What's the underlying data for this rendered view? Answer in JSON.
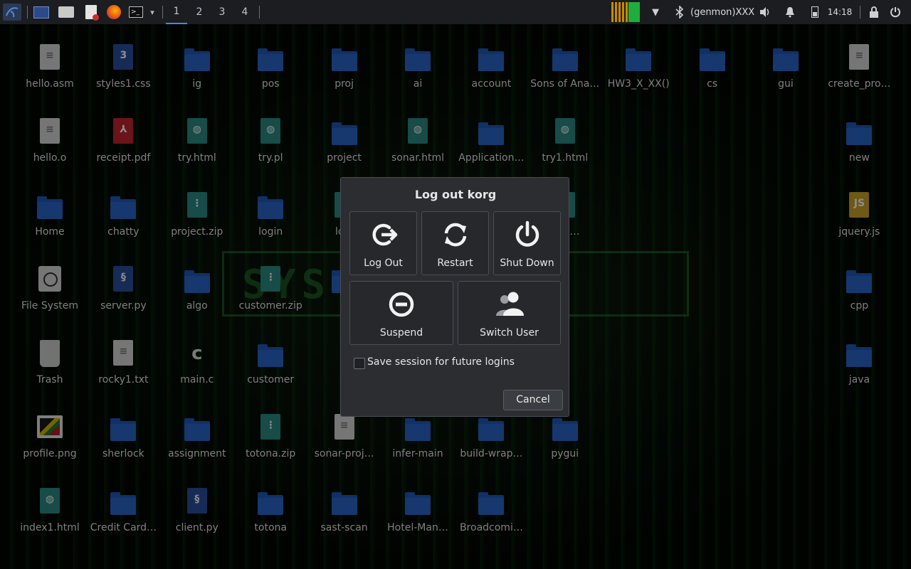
{
  "panel": {
    "workspaces": [
      "1",
      "2",
      "3",
      "4"
    ],
    "genmon": "(genmon)XXX",
    "clock": "14:18",
    "colors": {
      "panel_bg": "#1b1d20",
      "cpu_bar": "#c88a00",
      "net_bar": "#1fae3c"
    },
    "apps": [
      "kali-menu-icon",
      "desktop-icon",
      "file-manager-icon",
      "text-editor-icon",
      "firefox-icon",
      "terminal-icon"
    ]
  },
  "desktop": {
    "icons": [
      {
        "label": "hello.asm",
        "type": "doc"
      },
      {
        "label": "styles1.css",
        "type": "css"
      },
      {
        "label": "ig",
        "type": "folder"
      },
      {
        "label": "pos",
        "type": "folder"
      },
      {
        "label": "proj",
        "type": "folder"
      },
      {
        "label": "ai",
        "type": "folder"
      },
      {
        "label": "account",
        "type": "folder"
      },
      {
        "label": "Sons of Ana…",
        "type": "folder"
      },
      {
        "label": "HW3_X_XX()",
        "type": "folder"
      },
      {
        "label": "cs",
        "type": "folder"
      },
      {
        "label": "gui",
        "type": "folder"
      },
      {
        "label": "create_pro…",
        "type": "doc"
      },
      {
        "label": "hello.o",
        "type": "doc"
      },
      {
        "label": "receipt.pdf",
        "type": "pdf"
      },
      {
        "label": "try.html",
        "type": "html"
      },
      {
        "label": "try.pl",
        "type": "html"
      },
      {
        "label": "project",
        "type": "folder"
      },
      {
        "label": "sonar.html",
        "type": "html"
      },
      {
        "label": "Application…",
        "type": "folder"
      },
      {
        "label": "try1.html",
        "type": "html"
      },
      {
        "label": "new",
        "type": "folder"
      },
      {
        "label": "Home",
        "type": "folder"
      },
      {
        "label": "chatty",
        "type": "folder"
      },
      {
        "label": "project.zip",
        "type": "zip"
      },
      {
        "label": "login",
        "type": "folder"
      },
      {
        "label": "logi",
        "type": "zip"
      },
      {
        "label": "e.ht…",
        "type": "html"
      },
      {
        "label": "jquery.js",
        "type": "js"
      },
      {
        "label": "File System",
        "type": "drive"
      },
      {
        "label": "server.py",
        "type": "py"
      },
      {
        "label": "algo",
        "type": "folder"
      },
      {
        "label": "customer.zip",
        "type": "zip"
      },
      {
        "label": "cl",
        "type": "folder"
      },
      {
        "label": "cpp",
        "type": "folder"
      },
      {
        "label": "Trash",
        "type": "trash"
      },
      {
        "label": "rocky1.txt",
        "type": "doc"
      },
      {
        "label": "main.c",
        "type": "c"
      },
      {
        "label": "customer",
        "type": "folder"
      },
      {
        "label": "java",
        "type": "folder"
      },
      {
        "label": "profile.png",
        "type": "image"
      },
      {
        "label": "sherlock",
        "type": "folder"
      },
      {
        "label": "assignment",
        "type": "folder"
      },
      {
        "label": "totona.zip",
        "type": "zip"
      },
      {
        "label": "sonar-proj…",
        "type": "doc"
      },
      {
        "label": "infer-main",
        "type": "folder"
      },
      {
        "label": "build-wrap…",
        "type": "folder"
      },
      {
        "label": "pygui",
        "type": "folder"
      },
      {
        "label": "index1.html",
        "type": "html"
      },
      {
        "label": "Credit Card…",
        "type": "folder"
      },
      {
        "label": "client.py",
        "type": "py"
      },
      {
        "label": "totona",
        "type": "folder"
      },
      {
        "label": "sast-scan",
        "type": "folder"
      },
      {
        "label": "Hotel-Man…",
        "type": "folder"
      },
      {
        "label": "Broadcomi…",
        "type": "folder"
      }
    ]
  },
  "dialog": {
    "title": "Log out korg",
    "logout_label": "Log Out",
    "restart_label": "Restart",
    "shutdown_label": "Shut Down",
    "suspend_label": "Suspend",
    "switch_user_label": "Switch User",
    "save_session_label": "Save session for future logins",
    "save_session_checked": false,
    "cancel_label": "Cancel"
  },
  "background": {
    "banner_text": "SYS URE"
  }
}
